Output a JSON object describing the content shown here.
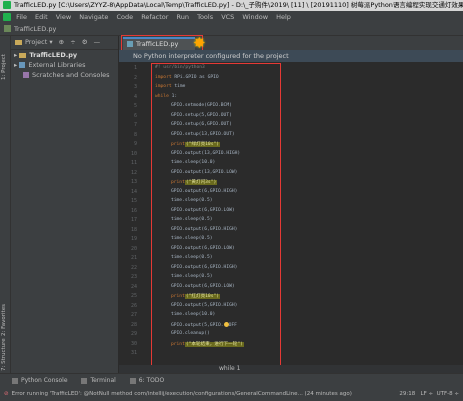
{
  "window": {
    "title": "TrafficLED.py [C:\\Users\\ZYYZ-8\\AppData\\Local\\Temp\\TrafficLED.py] - D:\\_子购件\\2019\\ [11] \\ [20191110] 树莓派Python语言编程实现交通灯效果\\功能\\"
  },
  "menu": {
    "items": [
      "File",
      "Edit",
      "View",
      "Navigate",
      "Code",
      "Refactor",
      "Run",
      "Tools",
      "VCS",
      "Window",
      "Help"
    ]
  },
  "nav": {
    "file": "TrafficLED.py"
  },
  "project": {
    "header_label": "Project",
    "header_icons": [
      "⊕",
      "÷",
      "⚙",
      "—"
    ],
    "items": [
      {
        "label": "TrafficLED.py"
      },
      {
        "label": "External Libraries"
      },
      {
        "label": "Scratches and Consoles"
      }
    ]
  },
  "left_strip": {
    "project": "1: Project",
    "favorites": "2: Favorites",
    "structure": "7: Structure"
  },
  "editor": {
    "tab": "TrafficLED.py",
    "notice": "No Python interpreter configured for the project",
    "breadcrumb": "while 1",
    "line_numbers": [
      "1",
      "2",
      "3",
      "4",
      "5",
      "6",
      "7",
      "8",
      "9",
      "10",
      "11",
      "12",
      "13",
      "14",
      "15",
      "16",
      "17",
      "18",
      "19",
      "20",
      "21",
      "22",
      "23",
      "24",
      "25",
      "26",
      "27",
      "28",
      "29",
      "30",
      "31"
    ]
  },
  "code": {
    "l1": "#! usr/bin/python3",
    "l2_kw": "import",
    "l2_rest": " RPi.GPIO as GPIO",
    "l3_kw": "import",
    "l3_rest": " time",
    "l4_kw": "while",
    "l4_rest": " 1:",
    "l5": "GPIO.setmode(GPIO.BCM)",
    "l6": "GPIO.setup(5,GPIO.OUT)",
    "l7": "GPIO.setup(6,GPIO.OUT)",
    "l8": "GPIO.setup(13,GPIO.OUT)",
    "l9_kw": "print",
    "l9_str": "(\"绿灯亮10s\")",
    "l10": "GPIO.output(13,GPIO.HIGH)",
    "l11": "time.sleep(10.0)",
    "l12": "GPIO.output(13,GPIO.LOW)",
    "l13_kw": "print",
    "l13_str": "(\"黄灯闪3s\")",
    "l14": "GPIO.output(6,GPIO.HIGH)",
    "l15": "time.sleep(0.5)",
    "l16": "GPIO.output(6,GPIO.LOW)",
    "l17": "time.sleep(0.5)",
    "l18": "GPIO.output(6,GPIO.HIGH)",
    "l19": "time.sleep(0.5)",
    "l20": "GPIO.output(6,GPIO.LOW)",
    "l21": "time.sleep(0.5)",
    "l22": "GPIO.output(6,GPIO.HIGH)",
    "l23": "time.sleep(0.5)",
    "l24": "GPIO.output(6,GPIO.LOW)",
    "l25_kw": "print",
    "l25_str": "(\"红灯亮10s\")",
    "l26": "GPIO.output(5,GPIO.HIGH)",
    "l27": "time.sleep(10.0)",
    "l28": "GPIO.output(5,GPIO.",
    "l28_tail": "OFF",
    "l29": "GPIO.cleanup()",
    "l30_kw": "print",
    "l30_str": "(\"本轮结束，进行下一轮\")"
  },
  "bottom_tools": {
    "console": "Python Console",
    "terminal": "Terminal",
    "todo": "6: TODO"
  },
  "status": {
    "error_text": "Error running 'TrafficLED': @NotNull method com/intellij/execution/configurations/GeneralCommandLine... (24 minutes ago)",
    "position": "29:18",
    "line_sep": "LF ÷",
    "encoding": "UTF-8 ÷"
  }
}
